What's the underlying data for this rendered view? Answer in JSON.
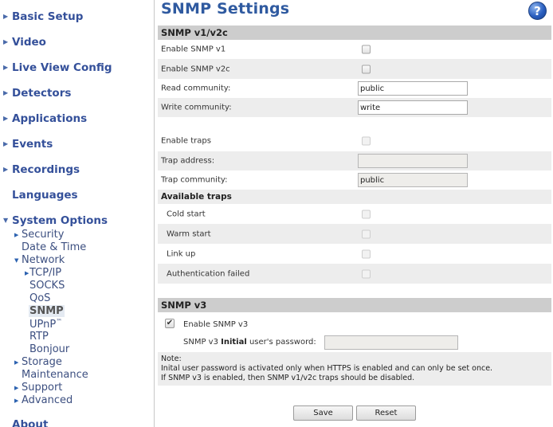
{
  "sidebar": {
    "top_items": [
      {
        "label": "Basic Setup",
        "icon": "triangle-right-icon"
      },
      {
        "label": "Video",
        "icon": "triangle-right-icon"
      },
      {
        "label": "Live View Config",
        "icon": "triangle-right-icon"
      },
      {
        "label": "Detectors",
        "icon": "triangle-right-icon"
      },
      {
        "label": "Applications",
        "icon": "triangle-right-icon"
      },
      {
        "label": "Events",
        "icon": "triangle-right-icon"
      },
      {
        "label": "Recordings",
        "icon": "triangle-right-icon"
      },
      {
        "label": "Languages",
        "icon": ""
      },
      {
        "label": "System Options",
        "icon": "triangle-down-icon"
      },
      {
        "label": "About",
        "icon": ""
      }
    ],
    "system_options_items": [
      {
        "label": "Security",
        "icon": "triangle-right-icon"
      },
      {
        "label": "Date & Time",
        "icon": ""
      },
      {
        "label": "Network",
        "icon": "triangle-down-icon"
      },
      {
        "label": "Storage",
        "icon": "triangle-right-icon"
      },
      {
        "label": "Maintenance",
        "icon": ""
      },
      {
        "label": "Support",
        "icon": "triangle-right-icon"
      },
      {
        "label": "Advanced",
        "icon": "triangle-right-icon"
      }
    ],
    "network_items": [
      {
        "label": "TCP/IP",
        "icon": "triangle-right-icon"
      },
      {
        "label": "SOCKS"
      },
      {
        "label": "QoS"
      },
      {
        "label": "SNMP",
        "active": true
      },
      {
        "label": "UPnP",
        "suffix": "™"
      },
      {
        "label": "RTP"
      },
      {
        "label": "Bonjour"
      }
    ],
    "arrow_right": "▶",
    "arrow_down": "▼"
  },
  "page": {
    "title": "SNMP Settings",
    "help_icon": "?",
    "v1v2c": {
      "header": "SNMP v1/v2c",
      "enable_v1_label": "Enable SNMP v1",
      "enable_v1_checked": false,
      "enable_v2c_label": "Enable SNMP v2c",
      "enable_v2c_checked": false,
      "read_community_label": "Read community:",
      "read_community_value": "public",
      "write_community_label": "Write community:",
      "write_community_value": "write",
      "enable_traps_label": "Enable traps",
      "enable_traps_checked": false,
      "trap_address_label": "Trap address:",
      "trap_address_value": "",
      "trap_community_label": "Trap community:",
      "trap_community_value": "public",
      "available_traps_label": "Available traps",
      "traps": [
        {
          "label": "Cold start",
          "checked": false
        },
        {
          "label": "Warm start",
          "checked": false
        },
        {
          "label": "Link up",
          "checked": false
        },
        {
          "label": "Authentication failed",
          "checked": false
        }
      ]
    },
    "v3": {
      "header": "SNMP v3",
      "enable_label": "Enable SNMP v3",
      "enable_checked": true,
      "check_glyph": "✔",
      "password_label_prefix": "SNMP v3 ",
      "password_label_bold": "Initial",
      "password_label_suffix": " user's password:",
      "password_value": ""
    },
    "note": {
      "title": "Note:",
      "line1": "Inital user password is activated only when HTTPS is enabled and can only be set once.",
      "line2": "If SNMP v3 is enabled, then SNMP v1/v2c traps should be disabled."
    },
    "buttons": {
      "save": "Save",
      "reset": "Reset"
    }
  }
}
